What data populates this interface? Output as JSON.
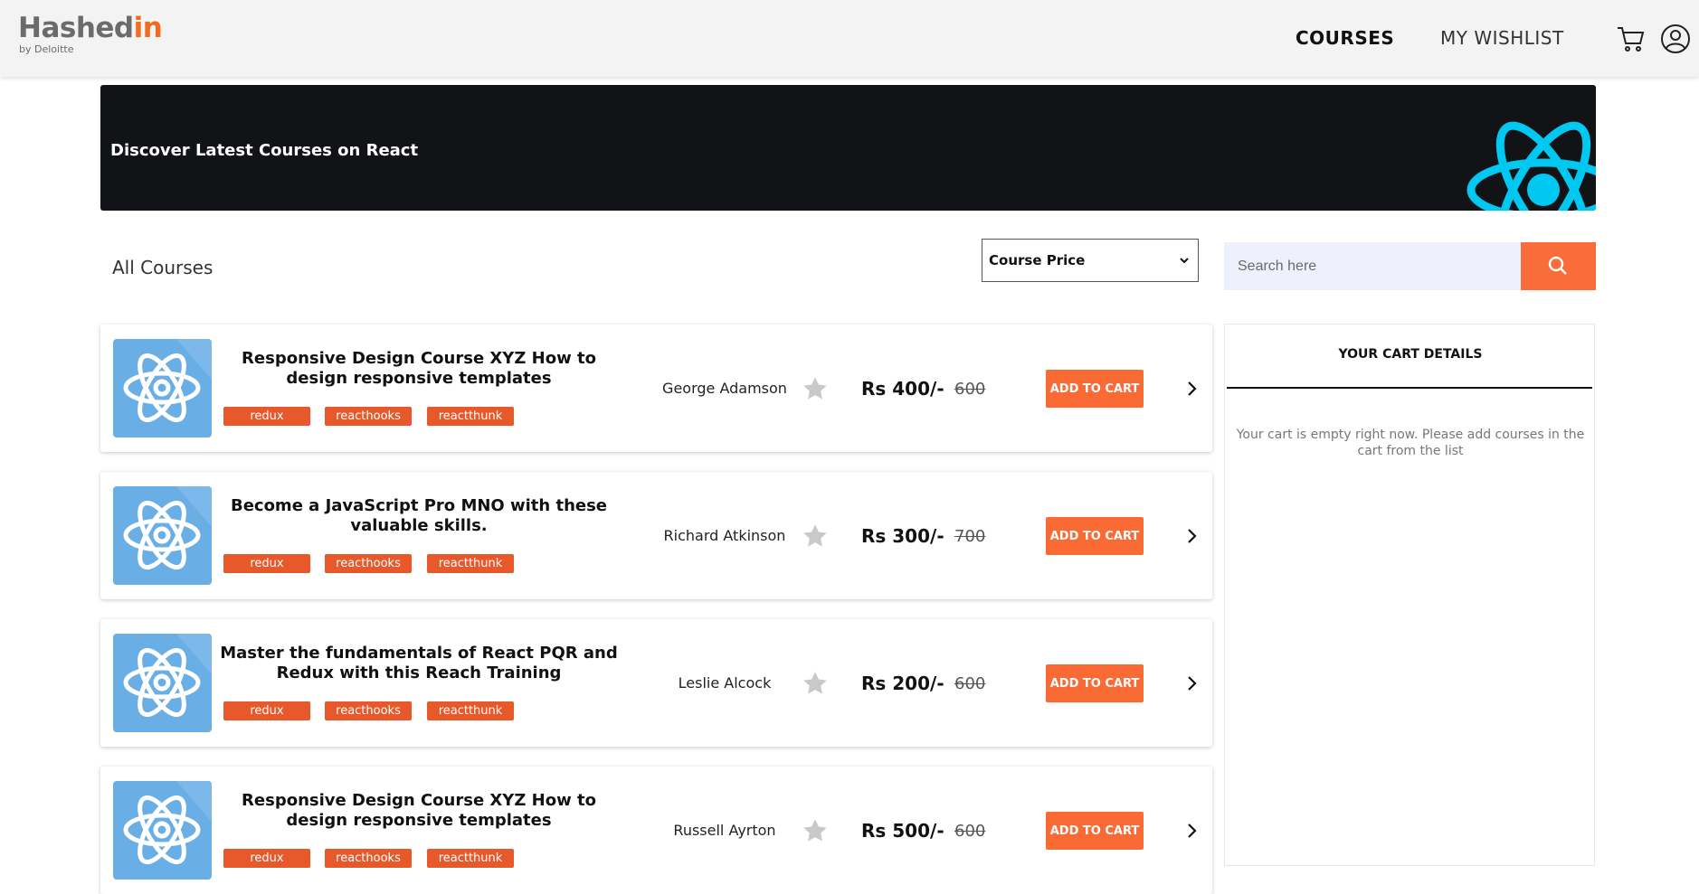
{
  "header": {
    "logo_main": "Hashed",
    "logo_accent": "in",
    "logo_sub": "by Deloitte",
    "nav": {
      "courses": "COURSES",
      "wishlist": "MY WISHLIST"
    },
    "icons": {
      "cart": "cart-icon",
      "user": "user-icon"
    }
  },
  "banner": {
    "title": "Discover Latest Courses on React",
    "icon": "react-logo"
  },
  "toolbar": {
    "section_title": "All Courses",
    "sort": {
      "selected": "Course Price"
    },
    "search": {
      "placeholder": "Search here",
      "button_icon": "search-icon"
    }
  },
  "courses": [
    {
      "title": "Responsive Design Course XYZ How to design responsive templates",
      "tags": [
        "redux",
        "reacthooks",
        "reactthunk"
      ],
      "author": "George Adamson",
      "price": "Rs 400/-",
      "old_price": "600",
      "button": "ADD TO CART"
    },
    {
      "title": "Become a JavaScript Pro MNO with these valuable skills.",
      "tags": [
        "redux",
        "reacthooks",
        "reactthunk"
      ],
      "author": "Richard Atkinson",
      "price": "Rs 300/-",
      "old_price": "700",
      "button": "ADD TO CART"
    },
    {
      "title": "Master the fundamentals of React PQR and Redux with this Reach Training",
      "tags": [
        "redux",
        "reacthooks",
        "reactthunk"
      ],
      "author": "Leslie Alcock",
      "price": "Rs 200/-",
      "old_price": "600",
      "button": "ADD TO CART"
    },
    {
      "title": "Responsive Design Course XYZ How to design responsive templates",
      "tags": [
        "redux",
        "reacthooks",
        "reactthunk"
      ],
      "author": "Russell Ayrton",
      "price": "Rs 500/-",
      "old_price": "600",
      "button": "ADD TO CART"
    }
  ],
  "cart": {
    "title": "YOUR CART DETAILS",
    "empty_message": "Your cart is empty right now. Please add courses in the cart from the list"
  },
  "colors": {
    "accent": "#f96d3a",
    "tag": "#e7582a",
    "banner_bg": "#111317",
    "react": "#00c8f0",
    "thumb": "#6aaee6"
  }
}
